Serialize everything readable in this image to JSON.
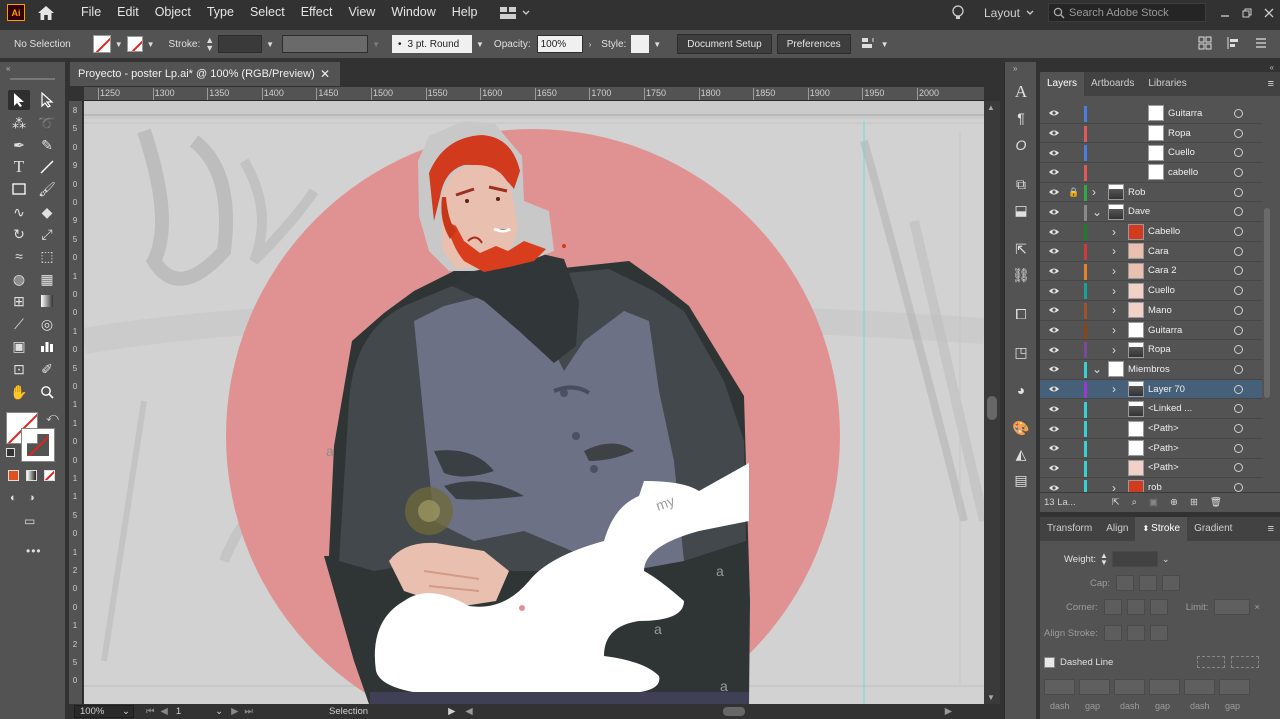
{
  "menubar": {
    "logo": "Ai",
    "items": [
      "File",
      "Edit",
      "Object",
      "Type",
      "Select",
      "Effect",
      "View",
      "Window",
      "Help"
    ],
    "workspace": "Layout",
    "stock_search_placeholder": "Search Adobe Stock"
  },
  "controlbar": {
    "selection": "No Selection",
    "stroke_label": "Stroke:",
    "brush": "3 pt. Round",
    "opacity_label": "Opacity:",
    "opacity": "100%",
    "style_label": "Style:",
    "document_setup": "Document Setup",
    "preferences": "Preferences"
  },
  "document": {
    "tab_title": "Proyecto - poster Lp.ai* @ 100% (RGB/Preview)",
    "ruler_h_ticks": [
      "1250",
      "1300",
      "1350",
      "1400",
      "1450",
      "1500",
      "1550",
      "1600",
      "1650",
      "1700",
      "1750",
      "1800",
      "1850",
      "1900",
      "1950",
      "2000"
    ],
    "ruler_v_ticks": [
      "8",
      "5",
      "0",
      "9",
      "0",
      "0",
      "9",
      "5",
      "0",
      "1",
      "0",
      "0",
      "1",
      "0",
      "5",
      "0",
      "1",
      "1",
      "0",
      "0",
      "1",
      "1",
      "5",
      "0",
      "1",
      "2",
      "0",
      "0",
      "1",
      "2",
      "5",
      "0"
    ]
  },
  "statusbar": {
    "zoom": "100%",
    "artboard": "1",
    "tool": "Selection"
  },
  "layers_panel": {
    "tabs": [
      "Layers",
      "Artboards",
      "Libraries"
    ],
    "rows": [
      {
        "name": "Guitarra",
        "depth": 2,
        "color": "#4a7fe0",
        "expand": "",
        "thumb": "white"
      },
      {
        "name": "Ropa",
        "depth": 2,
        "color": "#e05a5a",
        "expand": "",
        "thumb": "white"
      },
      {
        "name": "Cuello",
        "depth": 2,
        "color": "#4a7fe0",
        "expand": "",
        "thumb": "white"
      },
      {
        "name": "cabello",
        "depth": 2,
        "color": "#e05a5a",
        "expand": "",
        "thumb": "white"
      },
      {
        "name": "Rob",
        "depth": 0,
        "color": "#2fa84a",
        "expand": "›",
        "thumb": "figure",
        "locked": true
      },
      {
        "name": "Dave",
        "depth": 0,
        "color": "#8a8a8a",
        "expand": "⌄",
        "thumb": "figure"
      },
      {
        "name": "Cabello",
        "depth": 1,
        "color": "#1f7a2e",
        "expand": "›",
        "thumb": "red"
      },
      {
        "name": "Cara",
        "depth": 1,
        "color": "#d13a3a",
        "expand": "›",
        "thumb": "face"
      },
      {
        "name": "Cara 2",
        "depth": 1,
        "color": "#e8822a",
        "expand": "›",
        "thumb": "face"
      },
      {
        "name": "Cuello",
        "depth": 1,
        "color": "#17a39a",
        "expand": "›",
        "thumb": "skin"
      },
      {
        "name": "Mano",
        "depth": 1,
        "color": "#a0522d",
        "expand": "›",
        "thumb": "skin"
      },
      {
        "name": "Guitarra",
        "depth": 1,
        "color": "#8b4513",
        "expand": "›",
        "thumb": "white"
      },
      {
        "name": "Ropa",
        "depth": 1,
        "color": "#7a4a9a",
        "expand": "›",
        "thumb": "figure"
      },
      {
        "name": "Miembros",
        "depth": 0,
        "color": "#3ad1d1",
        "expand": "⌄",
        "thumb": "white"
      },
      {
        "name": "Layer 70",
        "depth": 1,
        "color": "#9a3ad1",
        "expand": "›",
        "thumb": "figure",
        "selected": true
      },
      {
        "name": "<Linked ...",
        "depth": 1,
        "color": "#3ad1d1",
        "expand": "",
        "thumb": "figure"
      },
      {
        "name": "<Path>",
        "depth": 1,
        "color": "#3ad1d1",
        "expand": "",
        "thumb": "white"
      },
      {
        "name": "<Path>",
        "depth": 1,
        "color": "#3ad1d1",
        "expand": "",
        "thumb": "white"
      },
      {
        "name": "<Path>",
        "depth": 1,
        "color": "#3ad1d1",
        "expand": "",
        "thumb": "skin"
      },
      {
        "name": "rob",
        "depth": 1,
        "color": "#3ad1d1",
        "expand": "›",
        "thumb": "red"
      }
    ],
    "count": "13 La..."
  },
  "stroke_panel": {
    "tabs": [
      "Transform",
      "Align",
      "Stroke",
      "Gradient"
    ],
    "weight_label": "Weight:",
    "cap_label": "Cap:",
    "corner_label": "Corner:",
    "limit_label": "Limit:",
    "align_label": "Align Stroke:",
    "dashed_label": "Dashed Line",
    "dash_labels": [
      "dash",
      "gap",
      "dash",
      "gap",
      "dash",
      "gap"
    ]
  },
  "art_colors": {
    "circle": "#e09292",
    "vest": "#6d7186",
    "shirt": "#3f4446",
    "hair": "#d13a1c",
    "guitar": "#ffffff",
    "skin": "#e9bfb0"
  }
}
